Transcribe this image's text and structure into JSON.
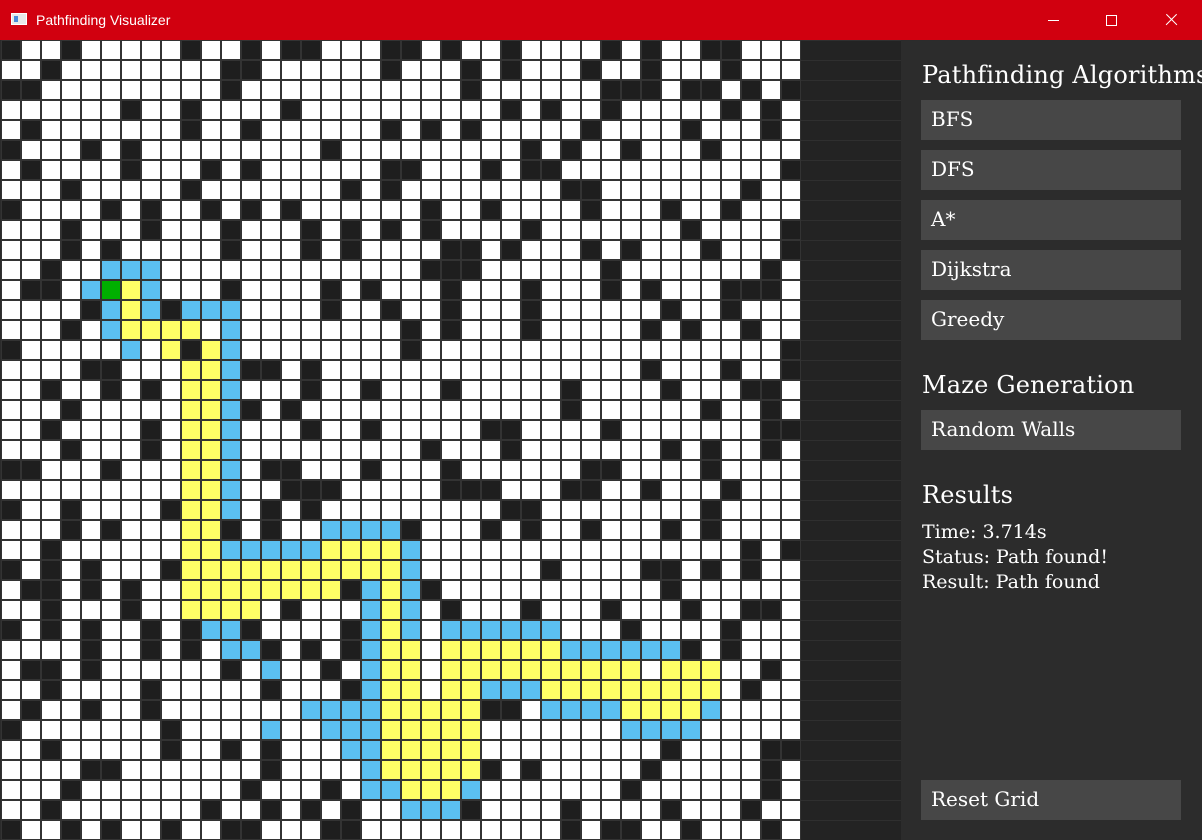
{
  "window": {
    "title": "Pathfinding Visualizer",
    "controls": [
      "minimize",
      "maximize",
      "close"
    ]
  },
  "sidebar": {
    "algorithms_title": "Pathfinding Algorithms",
    "algorithms": [
      "BFS",
      "DFS",
      "A*",
      "Dijkstra",
      "Greedy"
    ],
    "maze_title": "Maze Generation",
    "maze_button": "Random Walls",
    "results_title": "Results",
    "time": "Time: 3.714s",
    "status": "Status: Path found!",
    "result": "Result: Path found",
    "reset_button": "Reset Grid"
  },
  "colors": {
    "titlebar": "#d1000f",
    "wall": "#1e1e1e",
    "empty": "#ffffff",
    "visited": "#5bc0f2",
    "path": "#ffff66",
    "start": "#00b000",
    "grid_line": "#333333",
    "panel": "#2c2c2c",
    "button": "#474747"
  },
  "grid": {
    "cols": 40,
    "rows": 40,
    "start": [
      5,
      12
    ],
    "legend": "# wall, . empty, v visited, P path, S start",
    "cells": [
      "#..#.....#..#.##...##.#..#....#.#..##...",
      "..#........##......#...#.#...#..#...#...",
      "##.........#...........#......###.##.#.#",
      "......#..#....#..........#.#..#.....#.#.",
      ".#.......#..#......#.#.#.....#....#...#.",
      "#...#.#.........#.........#.#..#...#....",
      ".#....#...#.#......##...#.##...........#",
      "...#.....#.......#.#........##.......#..",
      "#....#.#..#.#.#......#..#....#...#..#...",
      "...#...#...#...#.#.#.#....#.......#....#",
      "...#.#.....#...#.#....##.#...#.#...#...#",
      "..#..vvv.............###......#.......#.",
      ".##.vSPv...#....#.#...#...#...#.#...###.",
      "....#vPv#.......#..#..#...#......#..#...",
      "...#.vPPPv..........#.#...#.....#.#..#..",
      "#.....v.P##.........#..................#",
      "....##...Pv.##.#................#...#..#",
      "..#..#.#.Pv....#..#...#.....#....#...##.",
      "...#......v.#.#.............#......#..#.",
      "..#....#..v....#..#.....##....#.......##",
      "...#...#..#..........#...#.......#.#..#.",
      "##...#....##.##...#...#......##....#....",
      "..............###.....###...##..#...#...",
      "#..#....#.#..#.#.........##........#....",
      "...#.#.....#.#......#...#.#..#...#.#....",
      "..#......vvvvvvvv.#..................#.#",
      "#.#.#...#v.P#.#..#.#.......#....##.#.#..",
      ".##.#.#..#.#.....#...#...........#......",
      "..#...#..v.#..#.......#...#...#...#..##.",
      "#.#.#..#.#..#....#....#........#....#...",
      "....#..#.#...#.#.#.......###.#...##.#...",
      ".##.#......#....#.#.#......#.....##...#.",
      "..#....#.....#...#.........#.....#...#..",
      ".#..#..#.......#..#....###.#.#..........",
      "#.......#....v...................##.....",
      "..#.....#..#.#...................#....##",
      "....##.......#..........#.#.....#.....#.",
      "...#........#...#..#...#.......#......#.",
      "..#.......#..#.#.#....##....#....#...#..",
      "#..#.#..#..##...##..........#.##..#...#."
    ],
    "path_cells": [
      [
        6,
        12
      ],
      [
        6,
        13
      ],
      [
        6,
        14
      ],
      [
        7,
        14
      ],
      [
        8,
        14
      ],
      [
        9,
        14
      ],
      [
        10,
        15
      ],
      [
        10,
        16
      ],
      [
        10,
        17
      ],
      [
        10,
        18
      ],
      [
        10,
        19
      ],
      [
        10,
        20
      ],
      [
        10,
        21
      ],
      [
        10,
        22
      ],
      [
        10,
        23
      ],
      [
        10,
        24
      ],
      [
        10,
        25
      ],
      [
        10,
        26
      ],
      [
        10,
        27
      ],
      [
        11,
        27
      ],
      [
        12,
        27
      ],
      [
        13,
        27
      ],
      [
        14,
        27
      ],
      [
        15,
        27
      ],
      [
        16,
        27
      ],
      [
        16,
        26
      ],
      [
        17,
        26
      ],
      [
        18,
        26
      ],
      [
        19,
        26
      ],
      [
        19,
        27
      ],
      [
        19,
        28
      ],
      [
        19,
        29
      ],
      [
        20,
        30
      ],
      [
        20,
        31
      ],
      [
        20,
        32
      ],
      [
        20,
        33
      ],
      [
        20,
        34
      ],
      [
        20,
        35
      ],
      [
        20,
        36
      ],
      [
        20,
        37
      ],
      [
        21,
        37
      ],
      [
        22,
        37
      ],
      [
        22,
        36
      ],
      [
        22,
        35
      ],
      [
        22,
        34
      ],
      [
        23,
        33
      ],
      [
        23,
        32
      ],
      [
        24,
        31
      ],
      [
        25,
        31
      ],
      [
        26,
        31
      ],
      [
        27,
        31
      ],
      [
        28,
        31
      ],
      [
        28,
        32
      ],
      [
        29,
        32
      ],
      [
        30,
        32
      ],
      [
        31,
        31
      ],
      [
        32,
        32
      ],
      [
        33,
        32
      ],
      [
        34,
        32
      ],
      [
        35,
        32
      ],
      [
        35,
        31
      ],
      [
        34,
        33
      ],
      [
        9,
        16
      ],
      [
        9,
        17
      ],
      [
        9,
        18
      ],
      [
        9,
        19
      ],
      [
        9,
        20
      ],
      [
        9,
        21
      ],
      [
        9,
        22
      ],
      [
        9,
        23
      ],
      [
        9,
        24
      ],
      [
        9,
        25
      ],
      [
        9,
        26
      ],
      [
        9,
        27
      ],
      [
        19,
        36
      ],
      [
        20,
        36
      ],
      [
        21,
        36
      ],
      [
        22,
        33
      ],
      [
        22,
        32
      ],
      [
        23,
        31
      ],
      [
        23,
        30
      ],
      [
        24,
        30
      ],
      [
        25,
        30
      ],
      [
        26,
        30
      ],
      [
        27,
        30
      ],
      [
        27,
        32
      ],
      [
        29,
        31
      ],
      [
        30,
        31
      ],
      [
        31,
        32
      ],
      [
        31,
        33
      ],
      [
        32,
        33
      ],
      [
        33,
        33
      ],
      [
        33,
        31
      ],
      [
        34,
        31
      ],
      [
        21,
        33
      ],
      [
        21,
        34
      ],
      [
        21,
        35
      ],
      [
        19,
        30
      ],
      [
        19,
        31
      ],
      [
        19,
        32
      ],
      [
        19,
        33
      ],
      [
        19,
        34
      ],
      [
        19,
        35
      ],
      [
        21,
        36
      ],
      [
        22,
        31
      ],
      [
        22,
        30
      ],
      [
        23,
        34
      ],
      [
        23,
        35
      ],
      [
        23,
        36
      ],
      [
        16,
        25
      ],
      [
        17,
        25
      ],
      [
        18,
        25
      ],
      [
        19,
        25
      ],
      [
        15,
        26
      ],
      [
        14,
        26
      ],
      [
        13,
        26
      ],
      [
        12,
        26
      ],
      [
        11,
        26
      ],
      [
        10,
        26
      ],
      [
        9,
        28
      ],
      [
        10,
        28
      ],
      [
        11,
        28
      ],
      [
        12,
        28
      ]
    ],
    "visited_cells": [
      [
        9,
        13
      ],
      [
        10,
        13
      ],
      [
        11,
        13
      ],
      [
        11,
        14
      ],
      [
        11,
        15
      ],
      [
        11,
        16
      ],
      [
        11,
        17
      ],
      [
        11,
        18
      ],
      [
        11,
        19
      ],
      [
        11,
        20
      ],
      [
        11,
        21
      ],
      [
        11,
        22
      ],
      [
        11,
        23
      ],
      [
        9,
        28
      ],
      [
        10,
        29
      ],
      [
        11,
        29
      ],
      [
        11,
        30
      ],
      [
        12,
        30
      ],
      [
        13,
        31
      ],
      [
        11,
        26
      ],
      [
        12,
        25
      ],
      [
        13,
        25
      ],
      [
        14,
        25
      ],
      [
        15,
        25
      ],
      [
        16,
        24
      ],
      [
        17,
        24
      ],
      [
        18,
        24
      ],
      [
        19,
        24
      ],
      [
        20,
        25
      ],
      [
        20,
        26
      ],
      [
        20,
        27
      ],
      [
        20,
        28
      ],
      [
        20,
        29
      ],
      [
        18,
        27
      ],
      [
        18,
        28
      ],
      [
        18,
        29
      ],
      [
        18,
        30
      ],
      [
        18,
        31
      ],
      [
        18,
        32
      ],
      [
        18,
        33
      ],
      [
        17,
        33
      ],
      [
        16,
        33
      ],
      [
        15,
        33
      ],
      [
        16,
        34
      ],
      [
        17,
        34
      ],
      [
        18,
        34
      ],
      [
        18,
        35
      ],
      [
        18,
        36
      ],
      [
        18,
        37
      ],
      [
        17,
        35
      ],
      [
        19,
        37
      ],
      [
        20,
        38
      ],
      [
        21,
        38
      ],
      [
        22,
        38
      ],
      [
        23,
        37
      ],
      [
        23,
        36
      ],
      [
        23,
        35
      ],
      [
        24,
        32
      ],
      [
        25,
        32
      ],
      [
        26,
        32
      ],
      [
        27,
        33
      ],
      [
        28,
        33
      ],
      [
        29,
        33
      ],
      [
        30,
        33
      ],
      [
        31,
        34
      ],
      [
        32,
        34
      ],
      [
        33,
        34
      ],
      [
        34,
        34
      ],
      [
        35,
        33
      ],
      [
        22,
        29
      ],
      [
        23,
        29
      ],
      [
        24,
        29
      ],
      [
        25,
        29
      ],
      [
        26,
        29
      ],
      [
        27,
        29
      ],
      [
        28,
        30
      ],
      [
        29,
        30
      ],
      [
        30,
        30
      ],
      [
        31,
        30
      ],
      [
        32,
        30
      ],
      [
        33,
        30
      ],
      [
        33,
        32
      ],
      [
        34,
        32
      ]
    ]
  }
}
